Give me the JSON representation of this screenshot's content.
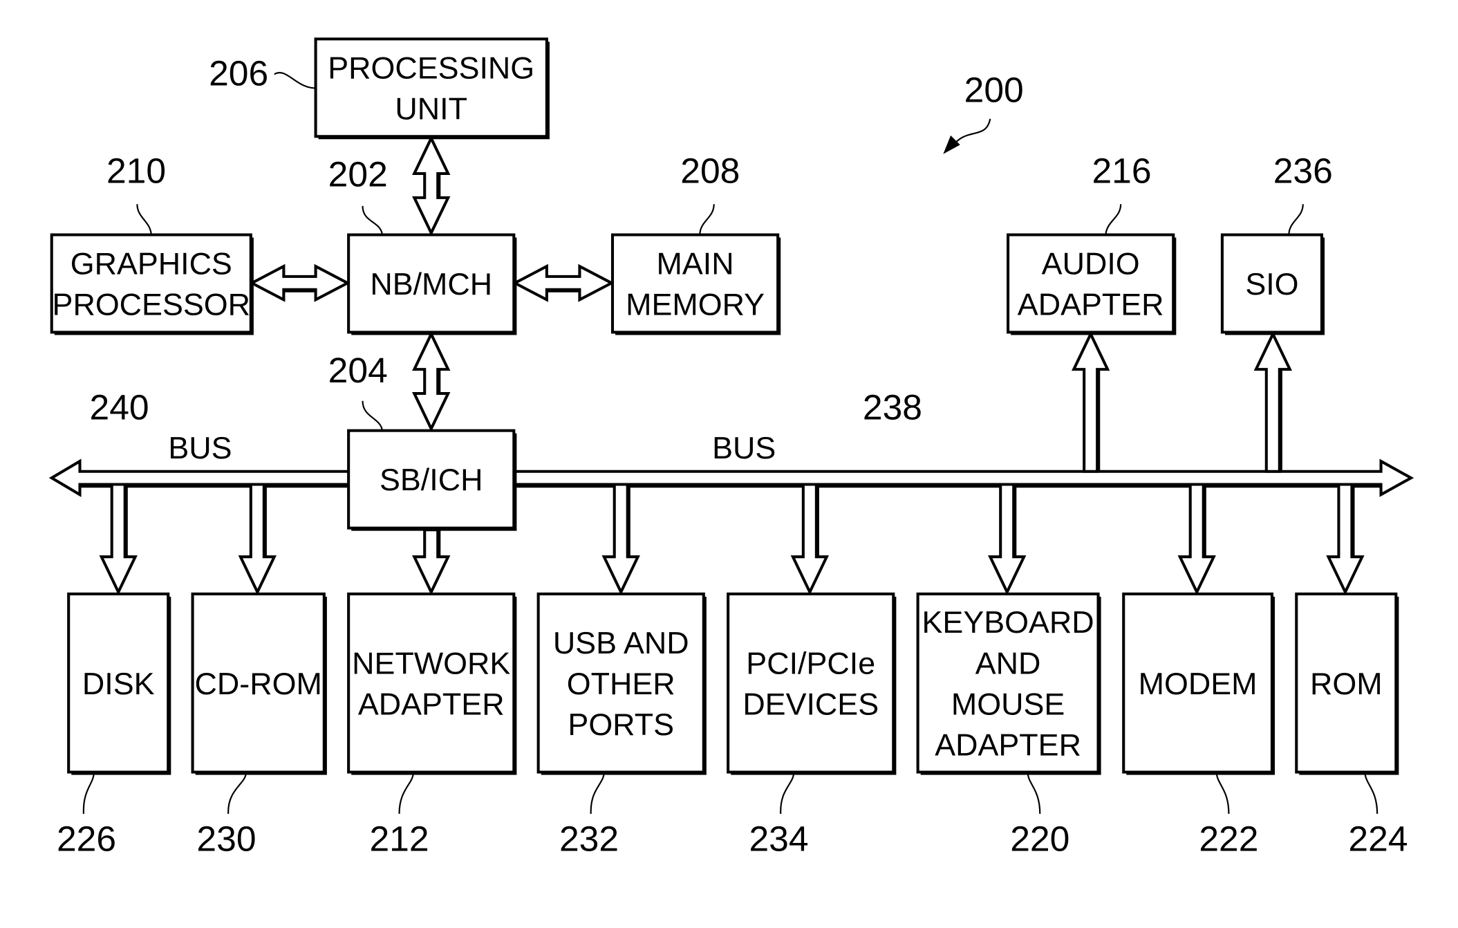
{
  "figure": {
    "reference": "200",
    "blocks": [
      {
        "id": "processing-unit",
        "ref": "206",
        "lines": [
          "PROCESSING",
          "UNIT"
        ]
      },
      {
        "id": "graphics-processor",
        "ref": "210",
        "lines": [
          "GRAPHICS",
          "PROCESSOR"
        ]
      },
      {
        "id": "nb-mch",
        "ref": "202",
        "lines": [
          "NB/MCH"
        ]
      },
      {
        "id": "main-memory",
        "ref": "208",
        "lines": [
          "MAIN",
          "MEMORY"
        ]
      },
      {
        "id": "audio-adapter",
        "ref": "216",
        "lines": [
          "AUDIO",
          "ADAPTER"
        ]
      },
      {
        "id": "sio",
        "ref": "236",
        "lines": [
          "SIO"
        ]
      },
      {
        "id": "sb-ich",
        "ref": "204",
        "lines": [
          "SB/ICH"
        ]
      },
      {
        "id": "disk",
        "ref": "226",
        "lines": [
          "DISK"
        ]
      },
      {
        "id": "cd-rom",
        "ref": "230",
        "lines": [
          "CD-ROM"
        ]
      },
      {
        "id": "network-adapter",
        "ref": "212",
        "lines": [
          "NETWORK",
          "ADAPTER"
        ]
      },
      {
        "id": "usb-ports",
        "ref": "232",
        "lines": [
          "USB AND",
          "OTHER",
          "PORTS"
        ]
      },
      {
        "id": "pci-devices",
        "ref": "234",
        "lines": [
          "PCI/PCIe",
          "DEVICES"
        ]
      },
      {
        "id": "keyboard-mouse-adapter",
        "ref": "220",
        "lines": [
          "KEYBOARD",
          "AND",
          "MOUSE",
          "ADAPTER"
        ]
      },
      {
        "id": "modem",
        "ref": "222",
        "lines": [
          "MODEM"
        ]
      },
      {
        "id": "rom",
        "ref": "224",
        "lines": [
          "ROM"
        ]
      }
    ],
    "buses": [
      {
        "id": "bus-left",
        "ref": "240",
        "label": "BUS"
      },
      {
        "id": "bus-right",
        "ref": "238",
        "label": "BUS"
      }
    ],
    "connections": [
      {
        "from": "processing-unit",
        "to": "nb-mch",
        "type": "bidirectional"
      },
      {
        "from": "graphics-processor",
        "to": "nb-mch",
        "type": "bidirectional"
      },
      {
        "from": "nb-mch",
        "to": "main-memory",
        "type": "bidirectional"
      },
      {
        "from": "nb-mch",
        "to": "sb-ich",
        "type": "bidirectional"
      },
      {
        "from": "sb-ich",
        "to": "network-adapter",
        "type": "unidirectional"
      },
      {
        "from": "bus-left",
        "to": "disk",
        "type": "unidirectional"
      },
      {
        "from": "bus-left",
        "to": "cd-rom",
        "type": "unidirectional"
      },
      {
        "from": "bus-right",
        "to": "usb-ports",
        "type": "unidirectional"
      },
      {
        "from": "bus-right",
        "to": "pci-devices",
        "type": "unidirectional"
      },
      {
        "from": "bus-right",
        "to": "keyboard-mouse-adapter",
        "type": "unidirectional"
      },
      {
        "from": "bus-right",
        "to": "modem",
        "type": "unidirectional"
      },
      {
        "from": "bus-right",
        "to": "rom",
        "type": "unidirectional"
      },
      {
        "from": "bus-right",
        "to": "audio-adapter",
        "type": "unidirectional"
      },
      {
        "from": "bus-right",
        "to": "sio",
        "type": "unidirectional"
      }
    ]
  }
}
